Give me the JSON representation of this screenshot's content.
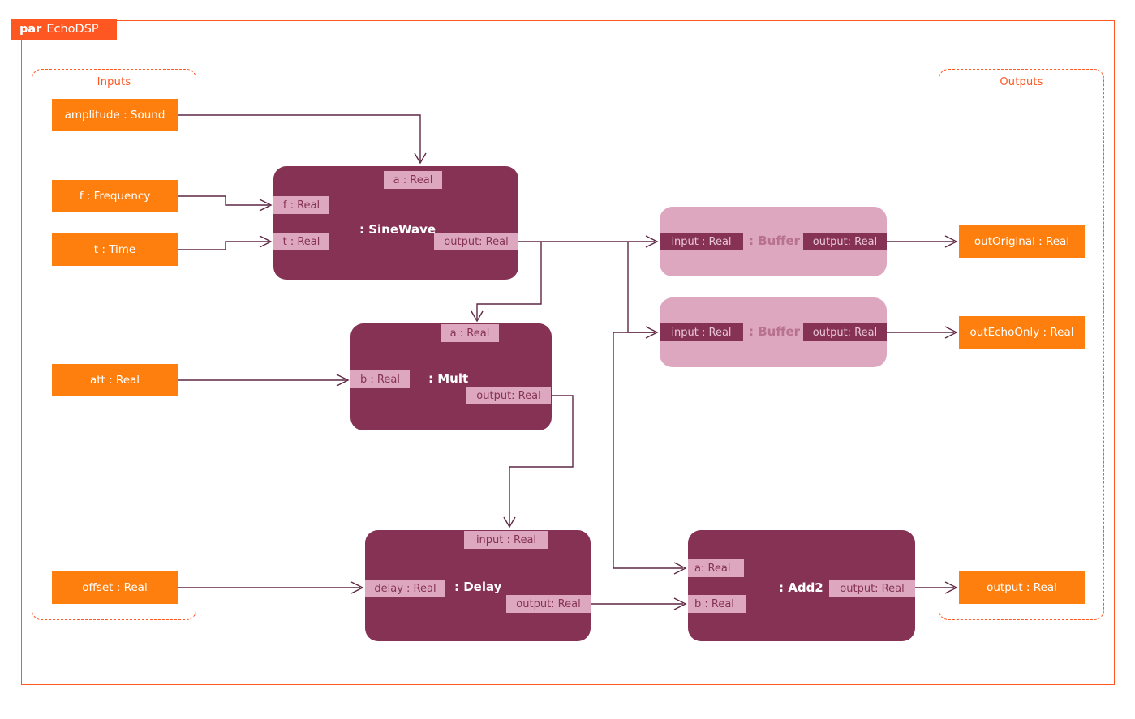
{
  "frame": {
    "keyword": "par",
    "name": "EchoDSP",
    "accent_color": "#ff5722"
  },
  "regions": [
    {
      "id": "inputs",
      "label": "Inputs"
    },
    {
      "id": "outputs",
      "label": "Outputs"
    }
  ],
  "colors": {
    "orange_port": "#ff7f0e",
    "accent": "#ff5722",
    "block_dark": "#853254",
    "block_light": "#dda7bf",
    "port_on_dark": "#dda7bf",
    "port_on_light": "#853254",
    "wire": "#5e2743"
  },
  "inputs": [
    {
      "id": "amplitude",
      "label": "amplitude : Sound"
    },
    {
      "id": "f",
      "label": "f : Frequency"
    },
    {
      "id": "t",
      "label": "t : Time"
    },
    {
      "id": "att",
      "label": "att : Real"
    },
    {
      "id": "offset",
      "label": "offset : Real"
    }
  ],
  "outputs": [
    {
      "id": "outOriginal",
      "label": "outOriginal : Real"
    },
    {
      "id": "outEchoOnly",
      "label": "outEchoOnly : Real"
    },
    {
      "id": "output",
      "label": "output : Real"
    }
  ],
  "blocks": [
    {
      "id": "sinewave",
      "name": ": SineWave",
      "style": "dark",
      "ports": [
        {
          "id": "sw-a",
          "label": "a : Real",
          "side": "top"
        },
        {
          "id": "sw-f",
          "label": "f : Real",
          "side": "left"
        },
        {
          "id": "sw-t",
          "label": "t : Real",
          "side": "left"
        },
        {
          "id": "sw-out",
          "label": "output: Real",
          "side": "right"
        }
      ]
    },
    {
      "id": "mult",
      "name": ": Mult",
      "style": "dark",
      "ports": [
        {
          "id": "mu-a",
          "label": "a : Real",
          "side": "top"
        },
        {
          "id": "mu-b",
          "label": "b : Real",
          "side": "left"
        },
        {
          "id": "mu-out",
          "label": "output: Real",
          "side": "right"
        }
      ]
    },
    {
      "id": "delay",
      "name": ": Delay",
      "style": "dark",
      "ports": [
        {
          "id": "de-in",
          "label": "input : Real",
          "side": "top"
        },
        {
          "id": "de-delay",
          "label": "delay : Real",
          "side": "left"
        },
        {
          "id": "de-out",
          "label": "output: Real",
          "side": "right"
        }
      ]
    },
    {
      "id": "add2",
      "name": ": Add2",
      "style": "dark",
      "ports": [
        {
          "id": "ad-a",
          "label": "a: Real",
          "side": "left"
        },
        {
          "id": "ad-b",
          "label": "b : Real",
          "side": "left"
        },
        {
          "id": "ad-out",
          "label": "output: Real",
          "side": "right"
        }
      ]
    },
    {
      "id": "buffer1",
      "name": ": Buffer",
      "style": "light",
      "ports": [
        {
          "id": "b1-in",
          "label": "input : Real",
          "side": "left"
        },
        {
          "id": "b1-out",
          "label": "output: Real",
          "side": "right"
        }
      ]
    },
    {
      "id": "buffer2",
      "name": ": Buffer",
      "style": "light",
      "ports": [
        {
          "id": "b2-in",
          "label": "input : Real",
          "side": "left"
        },
        {
          "id": "b2-out",
          "label": "output: Real",
          "side": "right"
        }
      ]
    }
  ],
  "connections": [
    {
      "from": "amplitude",
      "to": "sw-a"
    },
    {
      "from": "f",
      "to": "sw-f"
    },
    {
      "from": "t",
      "to": "sw-t"
    },
    {
      "from": "att",
      "to": "mu-b"
    },
    {
      "from": "offset",
      "to": "de-delay"
    },
    {
      "from": "sw-out",
      "to": "mu-a"
    },
    {
      "from": "sw-out",
      "to": "b1-in"
    },
    {
      "from": "sw-out",
      "to": "b2-in"
    },
    {
      "from": "sw-out",
      "to": "ad-a"
    },
    {
      "from": "mu-out",
      "to": "de-in"
    },
    {
      "from": "de-out",
      "to": "ad-b"
    },
    {
      "from": "b1-out",
      "to": "outOriginal"
    },
    {
      "from": "b2-out",
      "to": "outEchoOnly"
    },
    {
      "from": "ad-out",
      "to": "output"
    }
  ]
}
